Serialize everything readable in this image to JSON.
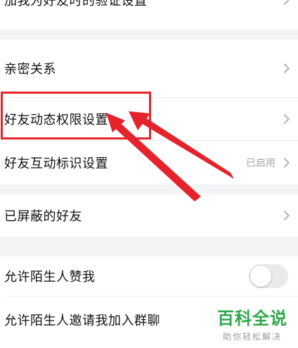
{
  "settings": {
    "group1": {
      "items": [
        {
          "label": "加我为好友时的验证设置"
        }
      ]
    },
    "group2": {
      "items": [
        {
          "label": "亲密关系"
        },
        {
          "label": "好友动态权限设置"
        },
        {
          "label": "好友互动标识设置",
          "trailing": "已启用"
        }
      ]
    },
    "group3": {
      "items": [
        {
          "label": "已屏蔽的好友"
        }
      ]
    },
    "group4": {
      "items": [
        {
          "label": "允许陌生人赞我",
          "toggle": false
        },
        {
          "label": "允许陌生人邀请我加入群聊"
        }
      ]
    }
  },
  "annotation": {
    "color": "#e4232c"
  },
  "watermark": {
    "title": "百科全说",
    "subtitle": "助你轻松解决",
    "color": "#2fa74a"
  }
}
